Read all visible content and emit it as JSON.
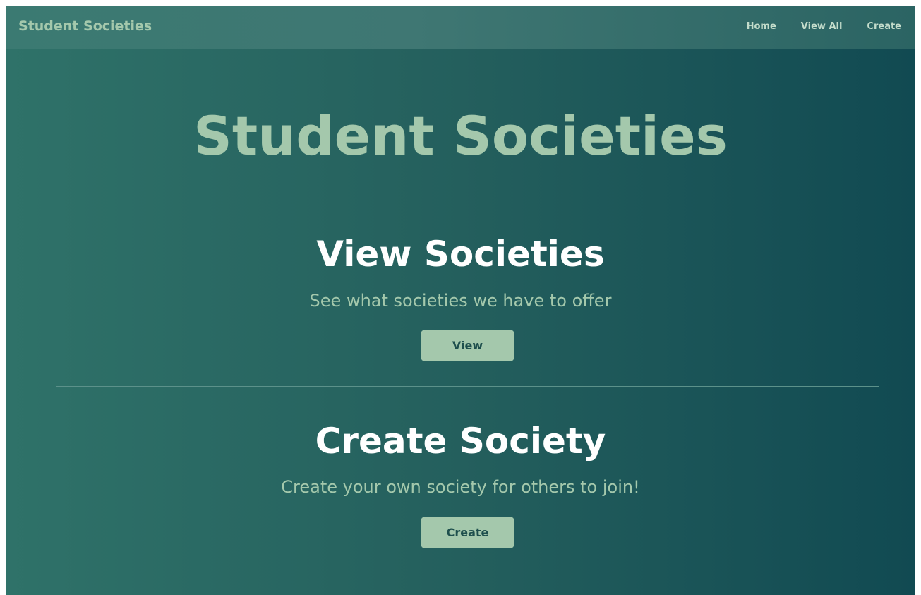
{
  "navbar": {
    "brand": "Student Societies",
    "links": [
      "Home",
      "View All",
      "Create"
    ]
  },
  "hero": {
    "title": "Student Societies"
  },
  "sections": [
    {
      "title": "View Societies",
      "subtitle": "See what societies we have to offer",
      "button_label": "View"
    },
    {
      "title": "Create Society",
      "subtitle": "Create your own society for others to join!",
      "button_label": "Create"
    }
  ],
  "colors": {
    "accent": "#a4c8ac",
    "background_left": "#2f7269",
    "background_right": "#114a52",
    "heading": "#ffffff"
  }
}
